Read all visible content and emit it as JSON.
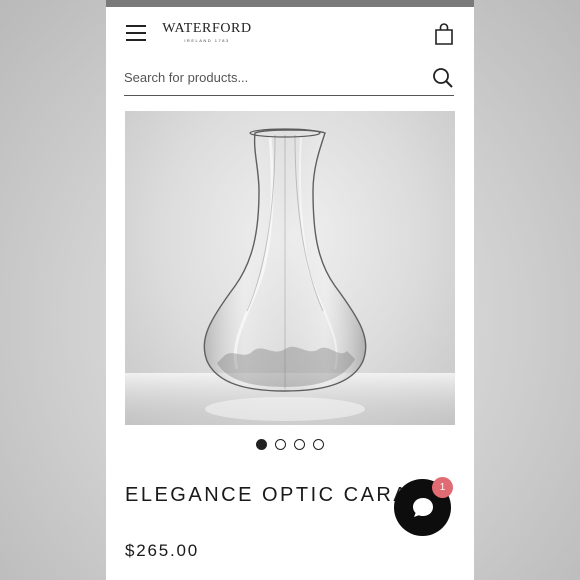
{
  "header": {
    "brand": "WATERFORD",
    "brand_sub": "IRELAND 1783",
    "menu_icon": "hamburger-menu-icon",
    "bag_icon": "shopping-bag-icon"
  },
  "search": {
    "placeholder": "Search for products...",
    "icon": "search-icon"
  },
  "product": {
    "title": "ELEGANCE OPTIC CARA",
    "price": "$265.00",
    "image_count": 4,
    "active_image": 1
  },
  "chat": {
    "icon": "chat-bubble-icon",
    "badge_count": "1"
  },
  "colors": {
    "badge": "#e06b73",
    "chat_button": "#0d0d0d",
    "text": "#1a1a1a"
  }
}
